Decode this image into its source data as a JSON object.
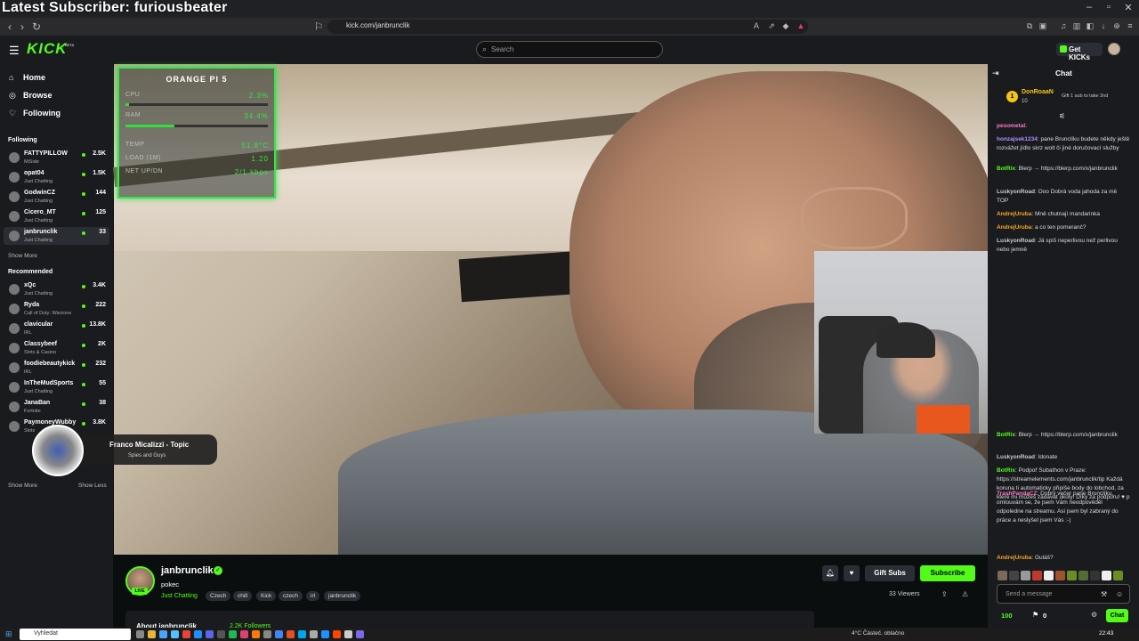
{
  "overlay": {
    "latest_subscriber": "Latest Subscriber: furiousbeater"
  },
  "browser": {
    "url": "kick.com/janbrunclik"
  },
  "header": {
    "logo": "KICK",
    "logo_beta": "BETA",
    "search_placeholder": "Search",
    "get_kicks": "Get KICKs"
  },
  "sidebar": {
    "nav": [
      {
        "label": "Home",
        "icon": "home-icon"
      },
      {
        "label": "Browse",
        "icon": "compass-icon"
      },
      {
        "label": "Following",
        "icon": "heart-icon"
      }
    ],
    "following_title": "Following",
    "following": [
      {
        "name": "FATTYPILLOW",
        "category": "MiSide",
        "viewers": "2.5K"
      },
      {
        "name": "opat04",
        "category": "Just Chatting",
        "viewers": "1.5K"
      },
      {
        "name": "GodwinCZ",
        "category": "Just Chatting",
        "viewers": "144"
      },
      {
        "name": "Cicero_MT",
        "category": "Just Chatting",
        "viewers": "125"
      },
      {
        "name": "janbrunclik",
        "category": "Just Chatting",
        "viewers": "33"
      }
    ],
    "show_more": "Show More",
    "recommended_title": "Recommended",
    "recommended": [
      {
        "name": "xQc",
        "category": "Just Chatting",
        "viewers": "3.4K"
      },
      {
        "name": "Ryda",
        "category": "Call of Duty: Warzone",
        "viewers": "222"
      },
      {
        "name": "clavicular",
        "category": "IRL",
        "viewers": "13.8K"
      },
      {
        "name": "Classybeef",
        "category": "Slots & Casino",
        "viewers": "2K"
      },
      {
        "name": "foodiebeautykick",
        "category": "IRL",
        "viewers": "232"
      },
      {
        "name": "InTheMudSports",
        "category": "Just Chatting",
        "viewers": "55"
      },
      {
        "name": "JanaBan",
        "category": "Fortnite",
        "viewers": "38"
      },
      {
        "name": "PaymoneyWubby",
        "category": "Slots",
        "viewers": "3.8K"
      }
    ],
    "show_more_2": "Show More",
    "show_less": "Show Less"
  },
  "stats": {
    "title": "ORANGE PI 5",
    "rows": [
      {
        "label": "CPU",
        "value": "2.3%",
        "bar": 0.023
      },
      {
        "label": "RAM",
        "value": "34.4%",
        "bar": 0.344
      },
      {
        "label": "TEMP",
        "value": "51.8°C"
      },
      {
        "label": "LOAD (1M)",
        "value": "1.20"
      },
      {
        "label": "NET UP/DN",
        "value": "2/1 kbps"
      }
    ]
  },
  "music": {
    "title": "Franco Micalizzi - Topic",
    "artist": "Spies and Guys"
  },
  "stream": {
    "streamer": "janbrunclik",
    "title": "pokec",
    "category": "Just Chatting",
    "tags": [
      "Czech",
      "chill",
      "Kick",
      "czech",
      "irl",
      "janbrunclik"
    ],
    "live": "LIVE",
    "gift_subs": "Gift Subs",
    "subscribe": "Subscribe",
    "viewers": "33 Viewers",
    "about": "About janbrunclik",
    "followers": "2.2K Followers"
  },
  "chat": {
    "title": "Chat",
    "pinned": {
      "rank": "1",
      "user": "DonRoaaN",
      "count": "10",
      "note": "Gift 1 sub to take 2nd"
    },
    "messages": [
      {
        "user": "pesometal",
        "color": "#ff79c6",
        "text": ""
      },
      {
        "user": "honzajsek1234",
        "color": "#b48cff",
        "text": "pane Brunclíku budete někdy ještě rozvážet jídlo skrz wolt či jiné doručovací služby"
      },
      {
        "user": "BotRix",
        "color": "#53fc18",
        "text": "Blerp → https://blerp.com/x/janbrunclik"
      },
      {
        "user": "LuskyonRoad",
        "color": "#cccccc",
        "text": "Ooo Dobrá voda jahoda za mě TOP"
      },
      {
        "user": "AndrejUruba",
        "color": "#f5a623",
        "text": "Mně chutnají mandarinka"
      },
      {
        "user": "AndrejUruba",
        "color": "#f5a623",
        "text": "a co ten pomeranč?"
      },
      {
        "user": "LuskyonRoad",
        "color": "#cccccc",
        "text": "Já spíš neperlivou než perlivou nebo jemně"
      },
      {
        "user": "BotRix",
        "color": "#53fc18",
        "text": "Blerp → https://blerp.com/x/janbrunclik"
      },
      {
        "user": "LuskyonRoad",
        "color": "#cccccc",
        "text": "Idonate"
      },
      {
        "user": "BotRix",
        "color": "#53fc18",
        "text": "Podpoř Subathon v Praze: https://streamelements.com/janbrunclik/tip Každá koruna ti automaticky připíše body do lobchod, za které mi můžeš zadávat úkoly! Díky za podporu! ♥ p"
      },
      {
        "user": "TrashPandaCZ",
        "color": "#ff79c6",
        "text": "Dobrý večer pane Brunclíku, omlouvám se, že jsem Vám neodpověděl odpoledne na streamu. Asi jsem byl zabraný do práce a neslyšel jsem Vás :-)"
      },
      {
        "user": "AndrejUruba",
        "color": "#f5a623",
        "text": "Guláš?"
      }
    ],
    "input_placeholder": "Send a message",
    "points": "100",
    "chest": "0",
    "send": "Chat"
  },
  "taskbar": {
    "search": "Vyhledat",
    "weather": "4°C  Částeč. oblačno",
    "time": "22:43"
  }
}
